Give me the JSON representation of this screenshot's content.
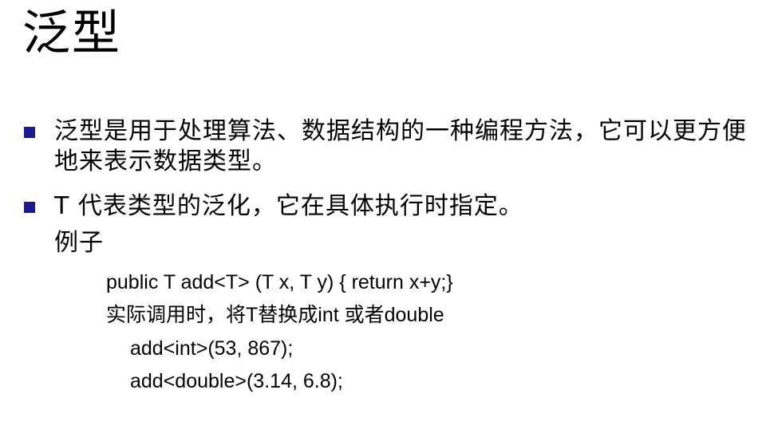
{
  "slide": {
    "title": "泛型",
    "bullets": [
      {
        "text": "泛型是用于处理算法、数据结构的一种编程方法，它可以更方便地来表示数据类型。"
      },
      {
        "text": "T 代表类型的泛化，它在具体执行时指定。"
      }
    ],
    "example_label": "例子",
    "code_lines": [
      "public T add<T> (T x, T y) { return x+y;}",
      "实际调用时，将T替换成int 或者double",
      "add<int>(53, 867);",
      "add<double>(3.14, 6.8);"
    ],
    "colors": {
      "bullet": "#1a1a8c",
      "text": "#000000",
      "background": "#ffffff"
    }
  }
}
